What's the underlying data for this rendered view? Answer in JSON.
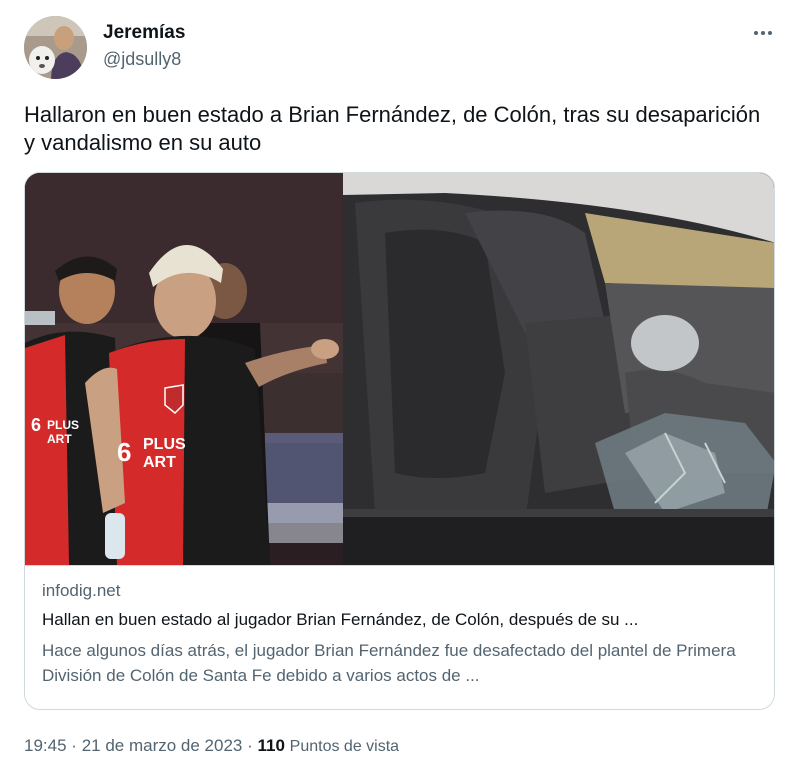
{
  "author": {
    "name": "Jeremías",
    "handle": "@jdsully8"
  },
  "tweet": {
    "text": "Hallaron en buen estado a Brian Fernández, de Colón, tras su desaparición y vandalismo en su auto"
  },
  "card": {
    "domain": "infodig.net",
    "title": "Hallan en buen estado al jugador Brian Fernández, de Colón, después de su ...",
    "description": "Hace algunos días atrás, el jugador Brian Fernández fue desafectado del plantel de Primera División de Colón de Santa Fe debido a varios actos de ...",
    "image_text": {
      "sponsor_1": "PLUS",
      "sponsor_2": "ART",
      "number": "6",
      "sponsor_left": "PLUS",
      "sponsor_left_2": "ART",
      "number_left": "6"
    }
  },
  "meta": {
    "time": "19:45",
    "separator": "·",
    "date": "21 de marzo de 2023",
    "views_count": "110",
    "views_label": "Puntos de vista"
  },
  "icons": {
    "more": "more-horizontal-icon"
  },
  "colors": {
    "text_primary": "#0f1419",
    "text_secondary": "#536471",
    "border": "#cfd9de",
    "jersey_red": "#d42a2a",
    "jersey_black": "#1b1b1b"
  }
}
